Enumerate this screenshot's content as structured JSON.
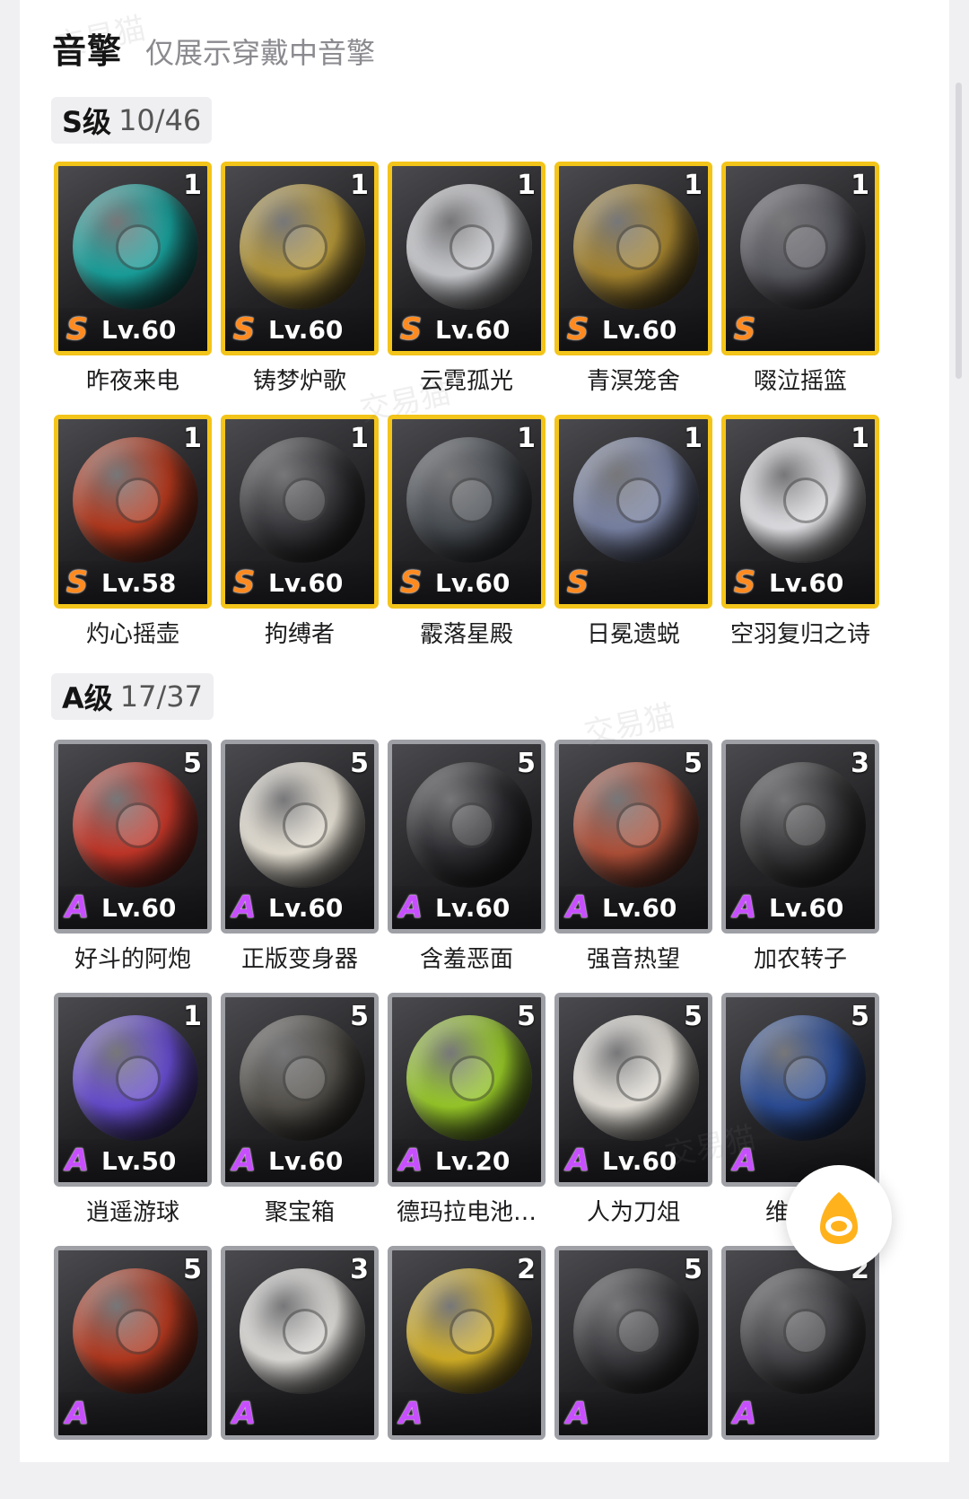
{
  "header": {
    "title": "音擎",
    "subtitle": "仅展示穿戴中音擎"
  },
  "s_section": {
    "label": "S级",
    "count": "10/46",
    "items": [
      {
        "name": "昨夜来电",
        "level": "Lv.60",
        "rank": "S",
        "stack": "1",
        "color": "#1aa5a0"
      },
      {
        "name": "铸梦炉歌",
        "level": "Lv.60",
        "rank": "S",
        "stack": "1",
        "color": "#b89a3a"
      },
      {
        "name": "云霓孤光",
        "level": "Lv.60",
        "rank": "S",
        "stack": "1",
        "color": "#cfd0d4"
      },
      {
        "name": "青溟笼舍",
        "level": "Lv.60",
        "rank": "S",
        "stack": "1",
        "color": "#a98730"
      },
      {
        "name": "啜泣摇篮",
        "level": "",
        "rank": "S",
        "stack": "1",
        "color": "#5a5a62"
      },
      {
        "name": "灼心摇壶",
        "level": "Lv.58",
        "rank": "S",
        "stack": "1",
        "color": "#b83a1e"
      },
      {
        "name": "拘缚者",
        "level": "Lv.60",
        "rank": "S",
        "stack": "1",
        "color": "#3a3a3e"
      },
      {
        "name": "霰落星殿",
        "level": "Lv.60",
        "rank": "S",
        "stack": "1",
        "color": "#4a4f55"
      },
      {
        "name": "日冕遗蜕",
        "level": "",
        "rank": "S",
        "stack": "1",
        "color": "#7c86a8"
      },
      {
        "name": "空羽复归之诗",
        "level": "Lv.60",
        "rank": "S",
        "stack": "1",
        "color": "#e8e8ec"
      }
    ]
  },
  "a_section": {
    "label": "A级",
    "count": "17/37",
    "items": [
      {
        "name": "好斗的阿炮",
        "level": "Lv.60",
        "rank": "A",
        "stack": "5",
        "color": "#c8382a"
      },
      {
        "name": "正版变身器",
        "level": "Lv.60",
        "rank": "A",
        "stack": "5",
        "color": "#efe9dc"
      },
      {
        "name": "含羞恶面",
        "level": "Lv.60",
        "rank": "A",
        "stack": "5",
        "color": "#2e2e32"
      },
      {
        "name": "强音热望",
        "level": "Lv.60",
        "rank": "A",
        "stack": "5",
        "color": "#b4523a"
      },
      {
        "name": "加农转子",
        "level": "Lv.60",
        "rank": "A",
        "stack": "3",
        "color": "#3a3a3c"
      },
      {
        "name": "逍遥游球",
        "level": "Lv.50",
        "rank": "A",
        "stack": "1",
        "color": "#6a4fd6"
      },
      {
        "name": "聚宝箱",
        "level": "Lv.60",
        "rank": "A",
        "stack": "5",
        "color": "#55524c"
      },
      {
        "name": "德玛拉电池…",
        "level": "Lv.20",
        "rank": "A",
        "stack": "5",
        "color": "#9ccf2a"
      },
      {
        "name": "人为刀俎",
        "level": "Lv.60",
        "rank": "A",
        "stack": "5",
        "color": "#eeeae2"
      },
      {
        "name": "维序者",
        "level": "",
        "rank": "A",
        "stack": "5",
        "color": "#2d4f9a"
      },
      {
        "name": "",
        "level": "",
        "rank": "A",
        "stack": "5",
        "color": "#b83a20"
      },
      {
        "name": "",
        "level": "",
        "rank": "A",
        "stack": "3",
        "color": "#e6e4e0"
      },
      {
        "name": "",
        "level": "",
        "rank": "A",
        "stack": "2",
        "color": "#d8b428"
      },
      {
        "name": "",
        "level": "",
        "rank": "A",
        "stack": "5",
        "color": "#3c3c40"
      },
      {
        "name": "",
        "level": "",
        "rank": "A",
        "stack": "2",
        "color": "#46464a"
      }
    ]
  },
  "watermark_text": "交易猫"
}
